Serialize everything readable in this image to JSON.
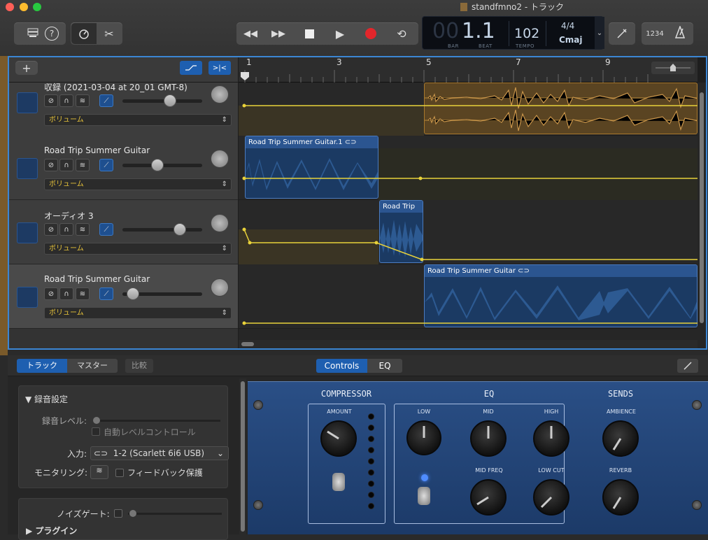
{
  "window": {
    "title": "standfmno2 - トラック"
  },
  "toolbar": {
    "library_icon": "library-icon",
    "help_label": "?",
    "smart_controls_icon": "smart-controls-icon",
    "editors_icon": "scissors-icon",
    "rewind_icon": "rewind-icon",
    "forward_icon": "fast-forward-icon",
    "stop_icon": "stop-icon",
    "play_icon": "play-icon",
    "record_icon": "record-icon",
    "cycle_icon": "cycle-icon",
    "tuner_icon": "tuner-icon",
    "count_in": "1234",
    "metronome_icon": "metronome-icon"
  },
  "lcd": {
    "bar": "00",
    "beat": "1.1",
    "bar_caption": "BAR",
    "beat_caption": "BEAT",
    "tempo": "102",
    "tempo_caption": "TEMPO",
    "signature": "4/4",
    "key": "Cmaj"
  },
  "tracks_header": {
    "add_label": "+"
  },
  "ruler": {
    "marks": [
      "1",
      "3",
      "5",
      "7",
      "9"
    ]
  },
  "tracks": [
    {
      "name": "収録 (2021-03-04 at 20_01 GMT-8)",
      "automation": "ボリューム"
    },
    {
      "name": "Road Trip Summer Guitar",
      "automation": "ボリューム"
    },
    {
      "name": "オーディオ 3",
      "automation": "ボリューム"
    },
    {
      "name": "Road Trip Summer Guitar",
      "automation": "ボリューム"
    }
  ],
  "regions": [
    {
      "name": "Road Trip Summer Guitar.1"
    },
    {
      "name": "Road Trip"
    },
    {
      "name": "Road Trip Summer Guitar"
    }
  ],
  "bottom_tabs": {
    "track": "トラック",
    "master": "マスター",
    "compare": "比較",
    "controls": "Controls",
    "eq": "EQ"
  },
  "recording": {
    "section": "録音設定",
    "level": "録音レベル:",
    "auto_level": "自動レベルコントロール",
    "input_label": "入力:",
    "input_value": "1-2  (Scarlett 6i6 USB)",
    "monitoring": "モニタリング:",
    "feedback": "フィードバック保護",
    "noise_gate": "ノイズゲート:",
    "plugins": "プラグイン"
  },
  "plugin": {
    "compressor": "COMPRESSOR",
    "eq": "EQ",
    "sends": "SENDS",
    "amount": "AMOUNT",
    "low": "LOW",
    "mid": "MID",
    "high": "HIGH",
    "mid_freq": "MID FREQ",
    "low_cut": "LOW CUT",
    "ambience": "AMBIENCE",
    "reverb": "REVERB"
  },
  "colors": {
    "accent": "#3b86d4",
    "automation": "#e8d23a",
    "region_blue": "#1b3a63",
    "region_orange": "#5a4422"
  }
}
